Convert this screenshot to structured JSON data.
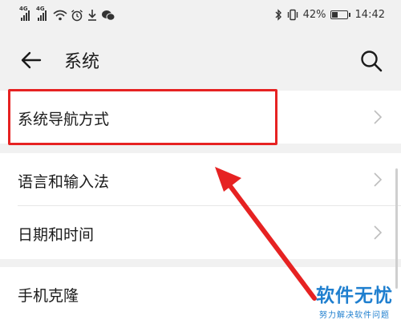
{
  "status_bar": {
    "signal1_tag": "4G",
    "signal2_tag": "4G",
    "icons": [
      "signal-icon",
      "signal-icon",
      "wifi-icon",
      "alarm-icon",
      "download-icon",
      "wechat-icon",
      "bluetooth-icon",
      "vibrate-icon",
      "battery-icon"
    ],
    "battery_text": "42%",
    "battery_level": 0.42,
    "time": "14:42"
  },
  "header": {
    "title": "系统",
    "back_icon": "back-arrow-icon",
    "search_icon": "search-icon"
  },
  "sections": [
    {
      "items": [
        {
          "label": "系统导航方式"
        }
      ]
    },
    {
      "items": [
        {
          "label": "语言和输入法"
        },
        {
          "label": "日期和时间"
        }
      ]
    },
    {
      "items": [
        {
          "label": "手机克隆"
        }
      ]
    }
  ],
  "annotation": {
    "highlight_color": "#e62222",
    "arrow_color": "#e62222"
  },
  "watermark": {
    "title": "软件无忧",
    "subtitle": "努力解决软件问题",
    "color": "#1f7fcf"
  }
}
